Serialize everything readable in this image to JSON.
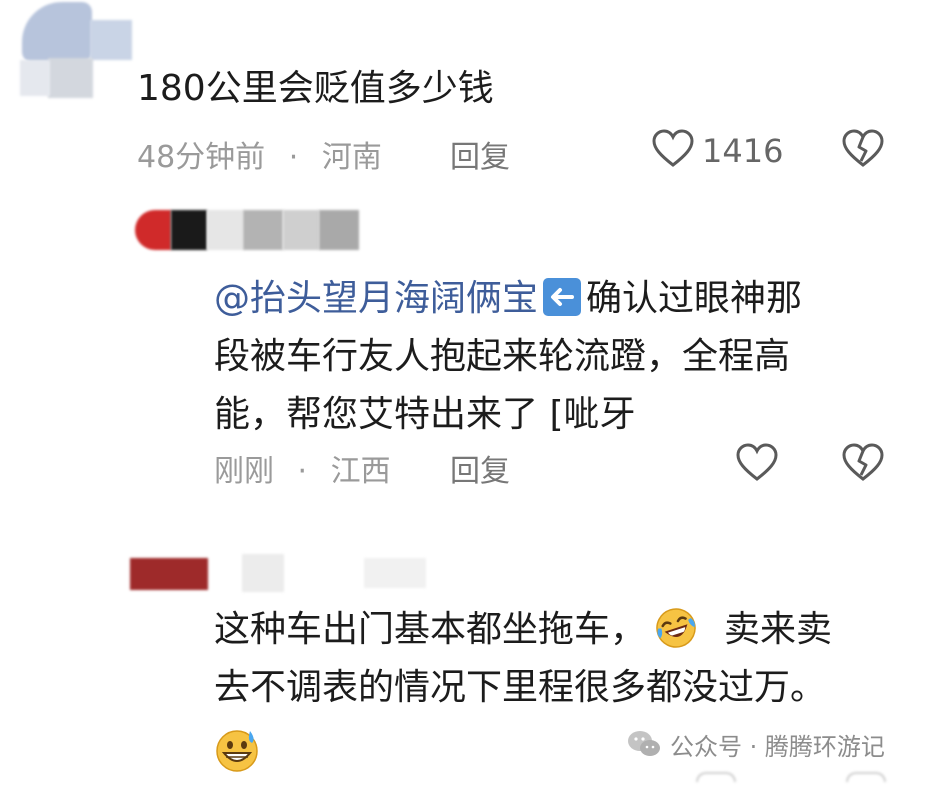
{
  "comments": [
    {
      "text": "180公里会贬值多少钱",
      "time": "48分钟前",
      "separator": "·",
      "location": "河南",
      "reply_label": "回复",
      "likes": "1416"
    },
    {
      "mention": "@抬头望月海阔俩宝",
      "text_line1": "确认过眼神那",
      "text_line2": "段被车行友人抱起来轮流蹬，全程高",
      "text_line3": "能，帮您艾特出来了 [呲牙",
      "time": "刚刚",
      "separator": "·",
      "location": "江西",
      "reply_label": "回复"
    },
    {
      "text_line1_a": "这种车出门基本都坐拖车，",
      "text_line1_b": "卖来卖",
      "text_line2": "去不调表的情况下里程很多都没过万。"
    }
  ],
  "watermark": {
    "text": "公众号 · 腾腾环游记"
  },
  "icons": {
    "like": "heart-outline-icon",
    "dislike": "broken-heart-icon",
    "arrow": "left-arrow-emoji-icon",
    "laugh": "laughing-tears-emoji-icon",
    "sweat": "grinning-sweat-emoji-icon",
    "wechat": "wechat-logo-icon"
  },
  "colors": {
    "mention": "#3e5d9a",
    "meta": "#9a9a9a",
    "arrow_bg": "#4a90d9"
  }
}
